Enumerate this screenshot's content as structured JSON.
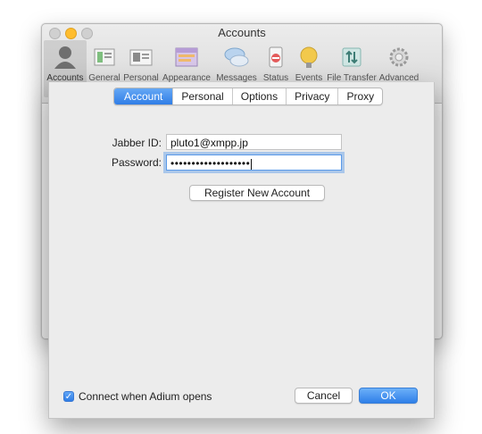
{
  "window": {
    "title": "Accounts"
  },
  "toolbar": {
    "items": [
      {
        "label": "Accounts",
        "icon": "accounts-icon"
      },
      {
        "label": "General",
        "icon": "general-icon"
      },
      {
        "label": "Personal",
        "icon": "personal-icon"
      },
      {
        "label": "Appearance",
        "icon": "appearance-icon"
      },
      {
        "label": "Messages",
        "icon": "messages-icon"
      },
      {
        "label": "Status",
        "icon": "status-icon"
      },
      {
        "label": "Events",
        "icon": "events-icon"
      },
      {
        "label": "File Transfer",
        "icon": "file-transfer-icon"
      },
      {
        "label": "Advanced",
        "icon": "advanced-icon"
      }
    ],
    "selected": "Accounts"
  },
  "sheet": {
    "tabs": [
      "Account",
      "Personal",
      "Options",
      "Privacy",
      "Proxy"
    ],
    "active_tab": "Account",
    "jabber_id_label": "Jabber ID:",
    "jabber_id_value": "pluto1@xmpp.jp",
    "password_label": "Password:",
    "password_masked": "•••••••••••••••••••",
    "register_button": "Register New Account",
    "connect_checkbox_label": "Connect when Adium opens",
    "connect_checked": true,
    "cancel_button": "Cancel",
    "ok_button": "OK"
  },
  "colors": {
    "accent": "#3a85ea",
    "traffic_minimize": "#ffbd2e"
  }
}
